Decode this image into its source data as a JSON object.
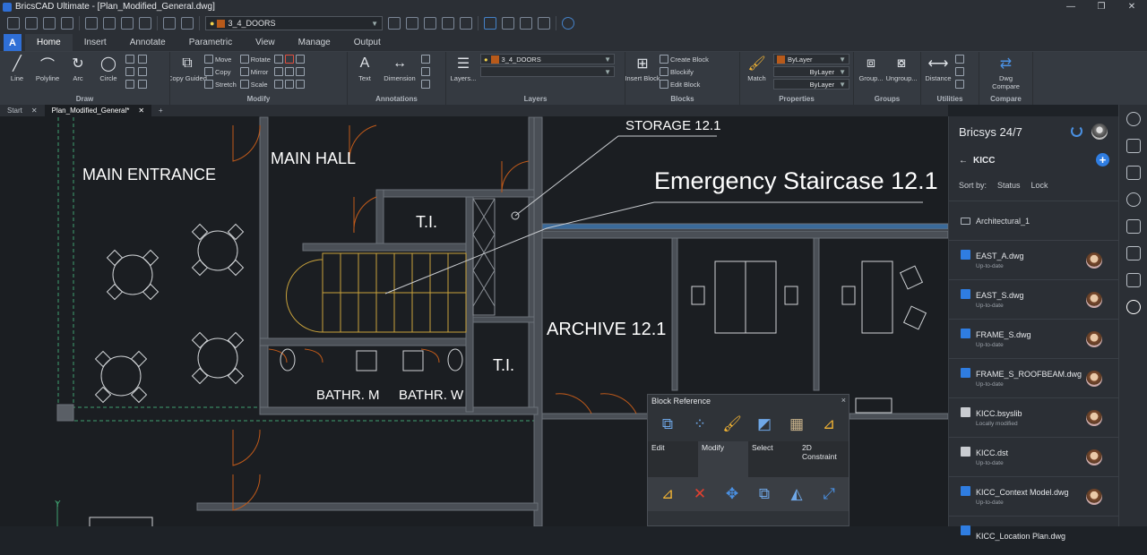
{
  "window": {
    "title": "BricsCAD Ultimate - [Plan_Modified_General.dwg]",
    "controls": [
      "—",
      "❐",
      "✕"
    ]
  },
  "qat": {
    "layer_value": "3_4_DOORS"
  },
  "ribbon_tabs": [
    "Home",
    "Insert",
    "Annotate",
    "Parametric",
    "View",
    "Manage",
    "Output"
  ],
  "ribbon": {
    "draw": {
      "title": "Draw",
      "items": [
        "Line",
        "Polyline",
        "Arc",
        "Circle"
      ]
    },
    "modify": {
      "title": "Modify",
      "copy_guided": "Copy Guided",
      "items": [
        "Move",
        "Rotate",
        "Copy",
        "Mirror",
        "Stretch",
        "Scale"
      ]
    },
    "annotations": {
      "title": "Annotations",
      "items": [
        "Text",
        "Dimension"
      ]
    },
    "layers": {
      "title": "Layers",
      "big": "Layers...",
      "current": "3_4_DOORS"
    },
    "blocks": {
      "title": "Blocks",
      "insert": "Insert Block",
      "items": [
        "Create Block",
        "Blockify",
        "Edit Block"
      ]
    },
    "properties": {
      "title": "Properties",
      "match": "Match",
      "values": [
        "ByLayer",
        "ByLayer",
        "ByLayer"
      ]
    },
    "groups": {
      "title": "Groups",
      "items": [
        "Group...",
        "Ungroup..."
      ]
    },
    "utilities": {
      "title": "Utilities",
      "items": [
        "Distance"
      ]
    },
    "compare": {
      "title": "Compare",
      "items": [
        "Dwg Compare"
      ]
    }
  },
  "doc_tabs": [
    "Start",
    "Plan_Modified_General*",
    "+"
  ],
  "drawing": {
    "labels": [
      "MAIN ENTRANCE",
      "MAIN HALL",
      "T.I.",
      "STORAGE 12.1",
      "Emergency Staircase 12.1",
      "ARCHIVE 12.1",
      "T.I.",
      "BATHR. M",
      "BATHR. W"
    ],
    "axis_y": "Y"
  },
  "quad": {
    "title": "Block Reference",
    "labels": [
      "Edit",
      "Modify",
      "Select",
      "2D Constraint"
    ],
    "close": "×"
  },
  "side_panel": {
    "title": "Bricsys 24/7",
    "project": "KICC",
    "sort_by": "Sort by:",
    "sort_options": [
      "Status",
      "Lock"
    ],
    "folder": "Architectural_1",
    "files": [
      {
        "name": "EAST_A.dwg",
        "status": "Up-to-date"
      },
      {
        "name": "EAST_S.dwg",
        "status": "Up-to-date"
      },
      {
        "name": "FRAME_S.dwg",
        "status": "Up-to-date"
      },
      {
        "name": "FRAME_S_ROOFBEAM.dwg",
        "status": "Up-to-date"
      },
      {
        "name": "KICC.bsyslib",
        "status": "Locally modified"
      },
      {
        "name": "KICC.dst",
        "status": "Up-to-date"
      },
      {
        "name": "KICC_Context Model.dwg",
        "status": "Up-to-date"
      },
      {
        "name": "KICC_Location Plan.dwg",
        "status": ""
      }
    ]
  }
}
